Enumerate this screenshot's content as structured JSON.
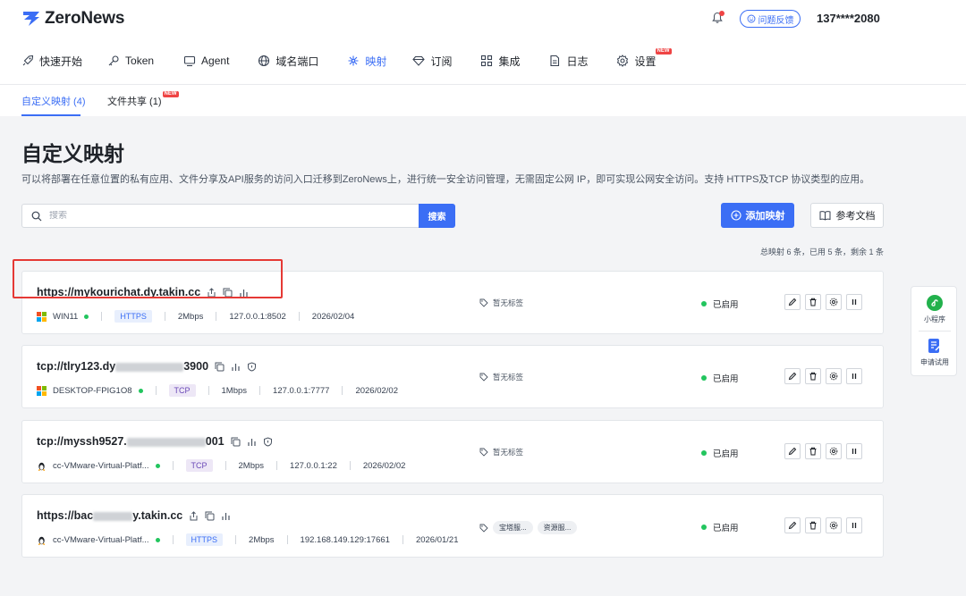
{
  "app": {
    "name": "ZeroNews",
    "feedback_label": "问题反馈",
    "user": "137****2080"
  },
  "nav": {
    "items": [
      {
        "label": "快速开始",
        "icon": "rocket-icon"
      },
      {
        "label": "Token",
        "icon": "key-icon"
      },
      {
        "label": "Agent",
        "icon": "monitor-icon"
      },
      {
        "label": "域名端口",
        "icon": "globe-icon"
      },
      {
        "label": "映射",
        "icon": "mapping-icon",
        "active": true
      },
      {
        "label": "订阅",
        "icon": "diamond-icon"
      },
      {
        "label": "集成",
        "icon": "grid-icon"
      },
      {
        "label": "日志",
        "icon": "document-icon"
      },
      {
        "label": "设置",
        "icon": "gear-icon",
        "badge": "NEW"
      }
    ]
  },
  "subtabs": [
    {
      "label": "自定义映射 (4)",
      "active": true
    },
    {
      "label": "文件共享 (1)",
      "badge": "NEW"
    }
  ],
  "page": {
    "title": "自定义映射",
    "description": "可以将部署在任意位置的私有应用、文件分享及API服务的访问入口迁移到ZeroNews上，进行统一安全访问管理，无需固定公网 IP，即可实现公网安全访问。支持 HTTPS及TCP 协议类型的应用。"
  },
  "search": {
    "placeholder": "搜索",
    "button_label": "搜索"
  },
  "toolbar": {
    "add_label": "添加映射",
    "docs_label": "参考文档"
  },
  "summary": "总映射 6 条，已用 5 条，剩余 1 条",
  "mappings": [
    {
      "url": "https://mykourichat.dy.takin.cc",
      "os": "windows",
      "agent": "WIN11",
      "protocol": "HTTPS",
      "bandwidth": "2Mbps",
      "target": "127.0.0.1:8502",
      "date": "2026/02/04",
      "tags_empty": "暂无标签",
      "status": "已启用"
    },
    {
      "url_prefix": "tcp://tlry123.dy",
      "url_suffix": "3900",
      "os": "windows",
      "agent": "DESKTOP-FPIG1O8",
      "protocol": "TCP",
      "bandwidth": "1Mbps",
      "target": "127.0.0.1:7777",
      "date": "2026/02/02",
      "tags_empty": "暂无标签",
      "status": "已启用"
    },
    {
      "url_prefix": "tcp://myssh9527.",
      "url_suffix": "001",
      "os": "linux",
      "agent": "cc-VMware-Virtual-Platf...",
      "protocol": "TCP",
      "bandwidth": "2Mbps",
      "target": "127.0.0.1:22",
      "date": "2026/02/02",
      "tags_empty": "暂无标签",
      "status": "已启用"
    },
    {
      "url_prefix": "https://bac",
      "url_suffix": "y.takin.cc",
      "os": "linux",
      "agent": "cc-VMware-Virtual-Platf...",
      "protocol": "HTTPS",
      "bandwidth": "2Mbps",
      "target": "192.168.149.129:17661",
      "date": "2026/01/21",
      "tags": [
        "宝塔服...",
        "资源服..."
      ],
      "status": "已启用"
    }
  ],
  "float_panel": {
    "mini_program": "小程序",
    "apply_trial": "申请试用"
  }
}
